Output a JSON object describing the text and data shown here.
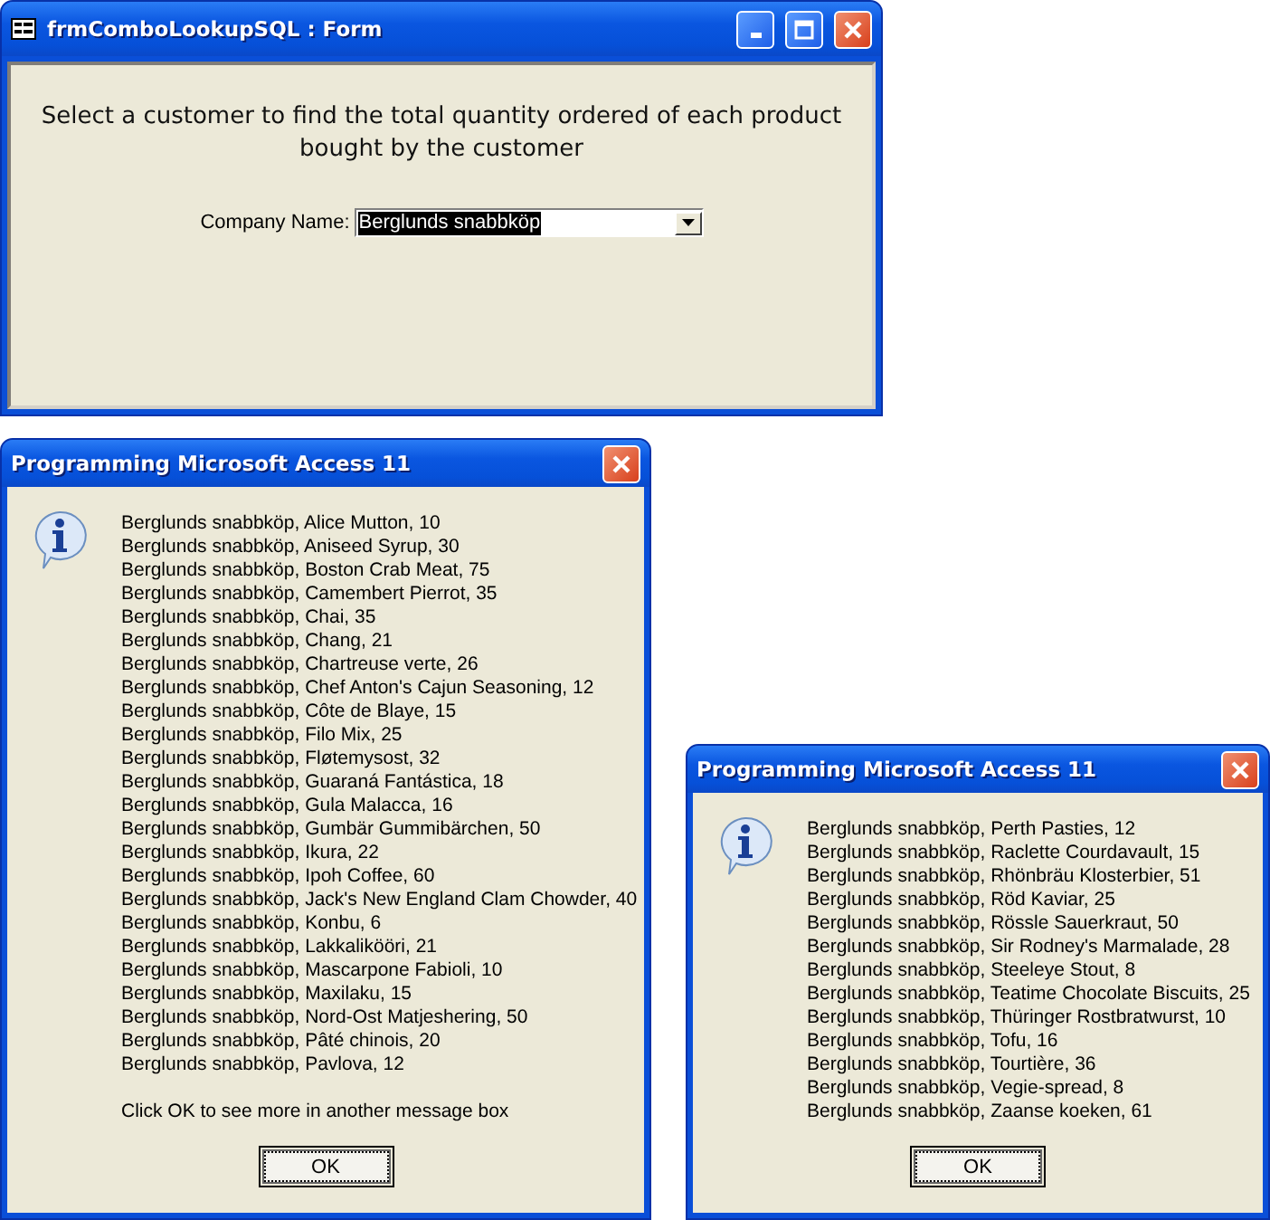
{
  "form_window": {
    "title": "frmComboLookupSQL : Form",
    "instructions": "Select a customer to find the total quantity ordered of each product bought by the customer",
    "company_field": {
      "label": "Company Name:",
      "value": "Berglunds snabbköp"
    }
  },
  "message_boxes": [
    {
      "title": "Programming Microsoft Access 11",
      "lines": [
        "Berglunds snabbköp, Alice Mutton, 10",
        "Berglunds snabbköp, Aniseed Syrup, 30",
        "Berglunds snabbköp, Boston Crab Meat, 75",
        "Berglunds snabbköp, Camembert Pierrot, 35",
        "Berglunds snabbköp, Chai, 35",
        "Berglunds snabbköp, Chang, 21",
        "Berglunds snabbköp, Chartreuse verte, 26",
        "Berglunds snabbköp, Chef Anton's Cajun Seasoning, 12",
        "Berglunds snabbköp, Côte de Blaye, 15",
        "Berglunds snabbköp, Filo Mix, 25",
        "Berglunds snabbköp, Fløtemysost, 32",
        "Berglunds snabbköp, Guaraná Fantástica, 18",
        "Berglunds snabbköp, Gula Malacca, 16",
        "Berglunds snabbköp, Gumbär Gummibärchen, 50",
        "Berglunds snabbköp, Ikura, 22",
        "Berglunds snabbköp, Ipoh Coffee, 60",
        "Berglunds snabbköp, Jack's New England Clam Chowder, 40",
        "Berglunds snabbköp, Konbu, 6",
        "Berglunds snabbköp, Lakkalikööri, 21",
        "Berglunds snabbköp, Mascarpone Fabioli, 10",
        "Berglunds snabbköp, Maxilaku, 15",
        "Berglunds snabbköp, Nord-Ost Matjeshering, 50",
        "Berglunds snabbköp, Pâté chinois, 20",
        "Berglunds snabbköp, Pavlova, 12"
      ],
      "note": "Click OK to see more in another message box",
      "button": "OK"
    },
    {
      "title": "Programming Microsoft Access 11",
      "lines": [
        "Berglunds snabbköp, Perth Pasties, 12",
        "Berglunds snabbköp, Raclette Courdavault, 15",
        "Berglunds snabbköp, Rhönbräu Klosterbier, 51",
        "Berglunds snabbköp, Röd Kaviar, 25",
        "Berglunds snabbköp, Rössle Sauerkraut, 50",
        "Berglunds snabbköp, Sir Rodney's Marmalade, 28",
        "Berglunds snabbköp, Steeleye Stout, 8",
        "Berglunds snabbköp, Teatime Chocolate Biscuits, 25",
        "Berglunds snabbköp, Thüringer Rostbratwurst, 10",
        "Berglunds snabbköp, Tofu, 16",
        "Berglunds snabbköp, Tourtière, 36",
        "Berglunds snabbköp, Vegie-spread, 8",
        "Berglunds snabbköp, Zaanse koeken, 61"
      ],
      "button": "OK"
    }
  ]
}
